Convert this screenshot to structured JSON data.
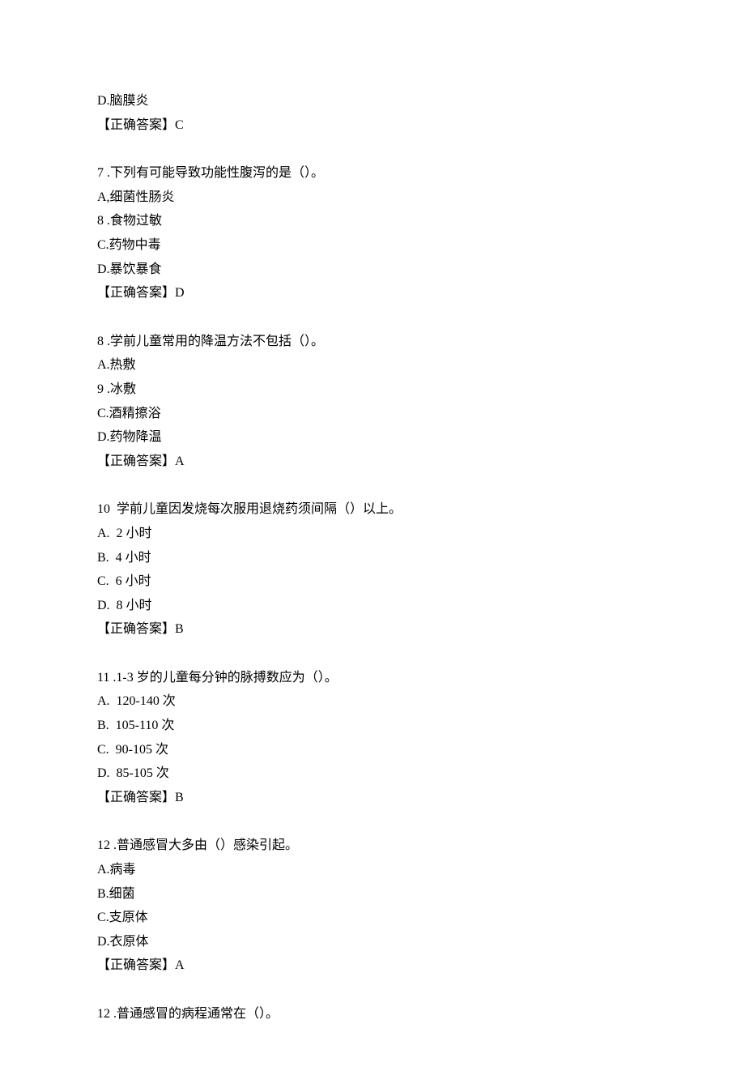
{
  "blocks": [
    {
      "lines": [
        "D.脑膜炎",
        "【正确答案】C"
      ]
    },
    {
      "lines": [
        "7 .下列有可能导致功能性腹泻的是（）。",
        "A,细菌性肠炎",
        "8 .食物过敏",
        "C.药物中毒",
        "D.暴饮暴食",
        "【正确答案】D"
      ]
    },
    {
      "lines": [
        "8 .学前儿童常用的降温方法不包括（）。",
        "A.热敷",
        "9 .冰敷",
        "C.酒精擦浴",
        "D.药物降温",
        "【正确答案】A"
      ]
    },
    {
      "lines": [
        "10  学前儿童因发烧每次服用退烧药须间隔（）以上。",
        "A.  2 小时",
        "B.  4 小时",
        "C.  6 小时",
        "D.  8 小时",
        "【正确答案】B"
      ]
    },
    {
      "lines": [
        "11 .1-3 岁的儿童每分钟的脉搏数应为（）。",
        "A.  120-140 次",
        "B.  105-110 次",
        "C.  90-105 次",
        "D.  85-105 次",
        "【正确答案】B"
      ]
    },
    {
      "lines": [
        "12 .普通感冒大多由（）感染引起。",
        "A.病毒",
        "B.细菌",
        "C.支原体",
        "D.衣原体",
        "【正确答案】A"
      ]
    },
    {
      "lines": [
        "12 .普通感冒的病程通常在（）。"
      ]
    }
  ]
}
